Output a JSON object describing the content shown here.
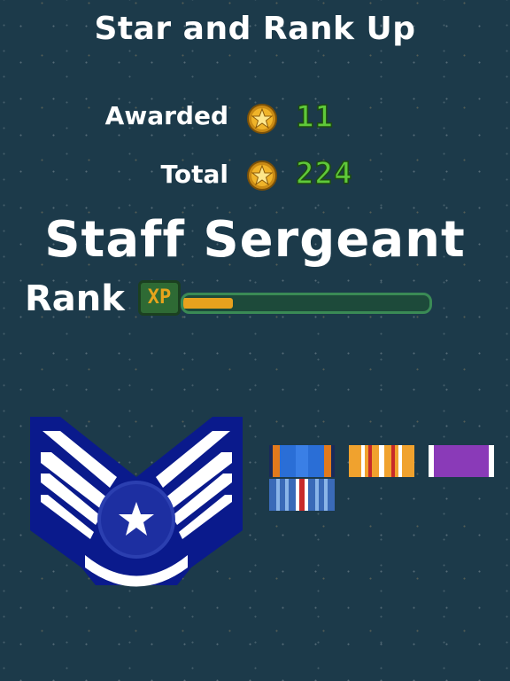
{
  "header": {
    "title": "Star and Rank Up"
  },
  "stats": {
    "awarded_label": "Awarded",
    "awarded_value": "11",
    "total_label": "Total",
    "total_value": "224"
  },
  "rank": {
    "name": "Staff Sergeant",
    "label": "Rank",
    "xp_badge": "XP",
    "xp_progress": 0.2
  },
  "icons": {
    "star": "star-medal-icon",
    "insignia": "staff-sergeant-chevron-icon"
  },
  "colors": {
    "background": "#1c3a4a",
    "stat_green": "#5fc93a",
    "xp_orange": "#e8a21e",
    "insignia_blue": "#0a1a8c"
  },
  "ribbons": [
    {
      "name": "ribbon-orange-blue"
    },
    {
      "name": "ribbon-orange-white-red"
    },
    {
      "name": "ribbon-purple-white"
    },
    {
      "name": "ribbon-blue-white-red"
    }
  ]
}
